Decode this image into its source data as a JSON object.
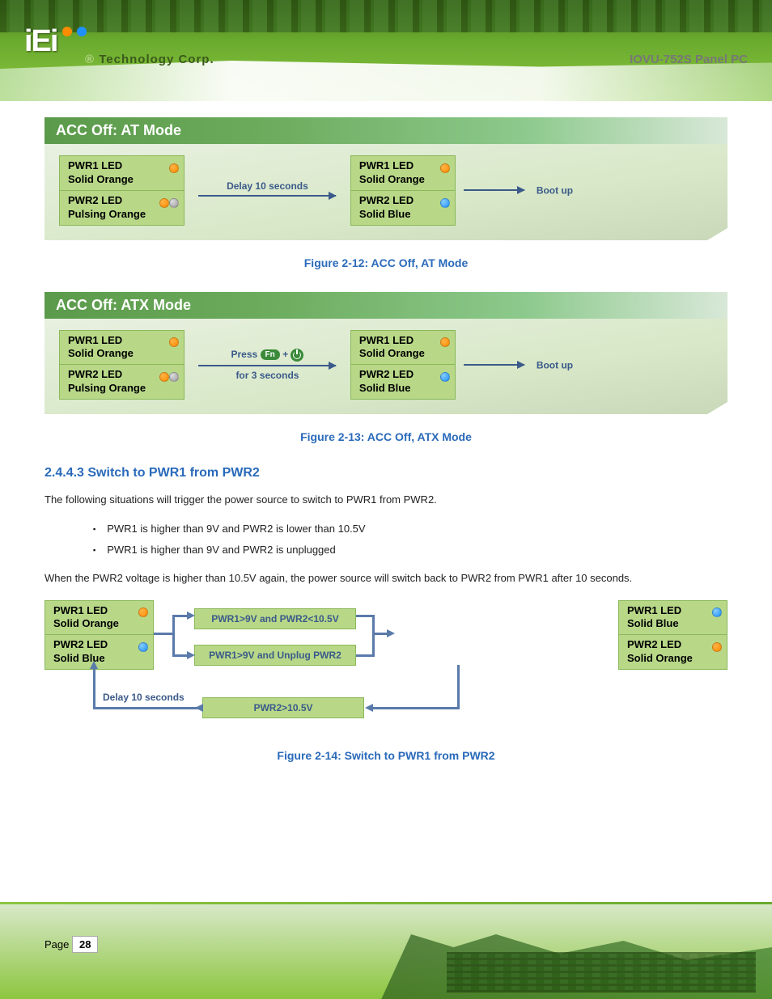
{
  "header": {
    "logo": "iEi",
    "tagline_r": "®",
    "tagline": "Technology Corp.",
    "title": "IOVU-752S Panel PC"
  },
  "diagram_at": {
    "title": "ACC Off: AT Mode",
    "left_top": "PWR1 LED\nSolid Orange",
    "left_bottom": "PWR2 LED\nPulsing Orange",
    "arrow_label": "Delay 10 seconds",
    "right_top": "PWR1 LED\nSolid Orange",
    "right_bottom": "PWR2 LED\nSolid Blue",
    "boot": "Boot up"
  },
  "caption_at": "Figure 2-12: ACC Off, AT Mode",
  "diagram_atx": {
    "title": "ACC Off: ATX Mode",
    "left_top": "PWR1 LED\nSolid Orange",
    "left_bottom": "PWR2 LED\nPulsing Orange",
    "press": "Press",
    "plus": "+",
    "for3": "for 3 seconds",
    "right_top": "PWR1 LED\nSolid Orange",
    "right_bottom": "PWR2 LED\nSolid Blue",
    "boot": "Boot up"
  },
  "caption_atx": "Figure 2-13: ACC Off, ATX Mode",
  "section_switch": {
    "heading": "2.4.4.3 Switch to PWR1 from PWR2",
    "para1": "The following situations will trigger the power source to switch to PWR1 from PWR2.",
    "bullets": [
      "PWR1 is higher than 9V and PWR2 is lower than 10.5V",
      "PWR1 is higher than 9V and PWR2 is unplugged"
    ],
    "para2": "When the PWR2 voltage is higher than 10.5V again, the power source will switch back to PWR2 from PWR1 after 10 seconds."
  },
  "switch_diagram": {
    "left_top": "PWR1 LED\nSolid Orange",
    "left_bottom": "PWR2 LED\nSolid Blue",
    "cond1": "PWR1>9V and PWR2<10.5V",
    "cond2": "PWR1>9V and Unplug PWR2",
    "right_top": "PWR1 LED\nSolid Blue",
    "right_bottom": "PWR2 LED\nSolid Orange",
    "delay": "Delay 10 seconds",
    "back_cond": "PWR2>10.5V"
  },
  "caption_switch": "Figure 2-14: Switch to PWR1 from PWR2",
  "footer": {
    "page_label": "Page 28",
    "page_num": "28"
  }
}
